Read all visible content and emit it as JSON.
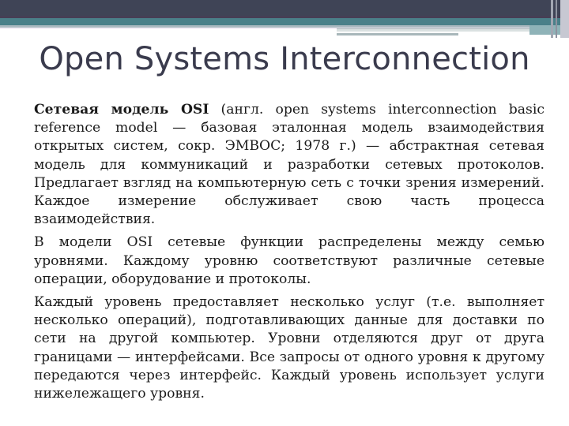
{
  "slide": {
    "title": "Open Systems Interconnection",
    "paragraphs": [
      {
        "lead_bold": "Сетевая модель OSI",
        "text": " (англ. open systems interconnection basic reference model — базовая эталонная модель взаимодействия открытых систем, сокр. ЭМВОС; 1978 г.) — абстрактная сетевая модель для коммуникаций и разработки сетевых протоколов. Предлагает взгляд на компьютерную сеть с точки зрения измерений. Каждое измерение обслуживает свою часть процесса взаимодействия."
      },
      {
        "text": "В модели OSI сетевые функции распределены между семью уровнями. Каждому уровню соответствуют различные сетевые операции, оборудование и протоколы."
      },
      {
        "text": "Каждый уровень предоставляет несколько услуг (т.е. выполняет несколько операций), подготавливающих данные для доставки по сети на другой компьютер. Уровни отделяются друг от друга границами — интерфейсами. Все запросы от одного уровня к другому передаются через интерфейс. Каждый уровень использует услуги нижележащего уровня."
      }
    ]
  },
  "theme": {
    "band_dark": "#3f4456",
    "band_teal": "#4a8089",
    "title_color": "#3a3b4d",
    "text_color": "#1a1a1a"
  }
}
